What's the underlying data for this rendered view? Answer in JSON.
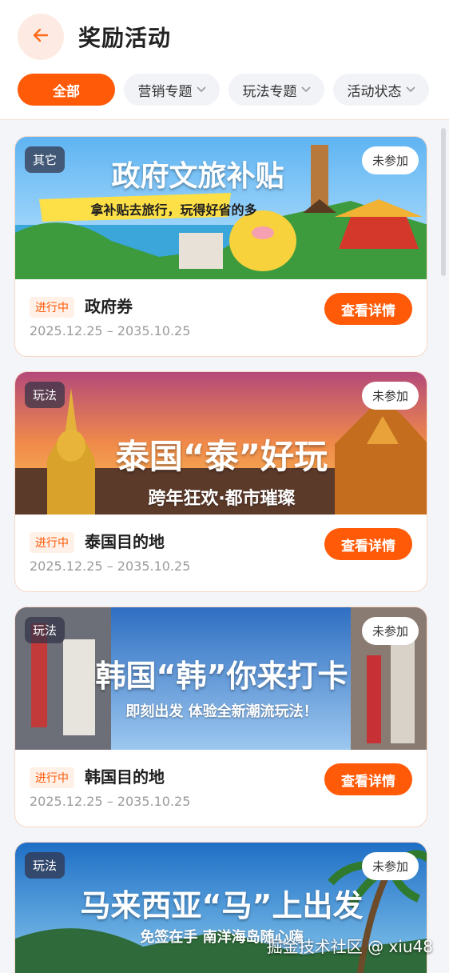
{
  "header": {
    "title": "奖励活动",
    "back_icon": "arrow-left-icon",
    "accent_color": "#ff5a07"
  },
  "filters": [
    {
      "label": "全部",
      "active": true
    },
    {
      "label": "营销专题",
      "active": false
    },
    {
      "label": "玩法专题",
      "active": false
    },
    {
      "label": "活动状态",
      "active": false
    }
  ],
  "cards": [
    {
      "type_tag": "其它",
      "join_status": "未参加",
      "banner_title": "政府文旅补贴",
      "banner_sub": "拿补贴去旅行，玩得好省的多",
      "status": "进行中",
      "name": "政府券",
      "date_range": "2025.12.25 – 2035.10.25",
      "button": "查看详情"
    },
    {
      "type_tag": "玩法",
      "join_status": "未参加",
      "banner_title": "泰国“泰”好玩",
      "banner_sub": "跨年狂欢·都市璀璨",
      "status": "进行中",
      "name": "泰国目的地",
      "date_range": "2025.12.25 – 2035.10.25",
      "button": "查看详情"
    },
    {
      "type_tag": "玩法",
      "join_status": "未参加",
      "banner_title": "韩国“韩”你来打卡",
      "banner_sub": "即刻出发 体验全新潮流玩法！",
      "status": "进行中",
      "name": "韩国目的地",
      "date_range": "2025.12.25 – 2035.10.25",
      "button": "查看详情"
    },
    {
      "type_tag": "玩法",
      "join_status": "未参加",
      "banner_title": "马来西亚“马”上出发",
      "banner_sub": "免签在手 南洋海岛随心嗨"
    }
  ],
  "watermark": "掘金技术社区 @ xiu48"
}
